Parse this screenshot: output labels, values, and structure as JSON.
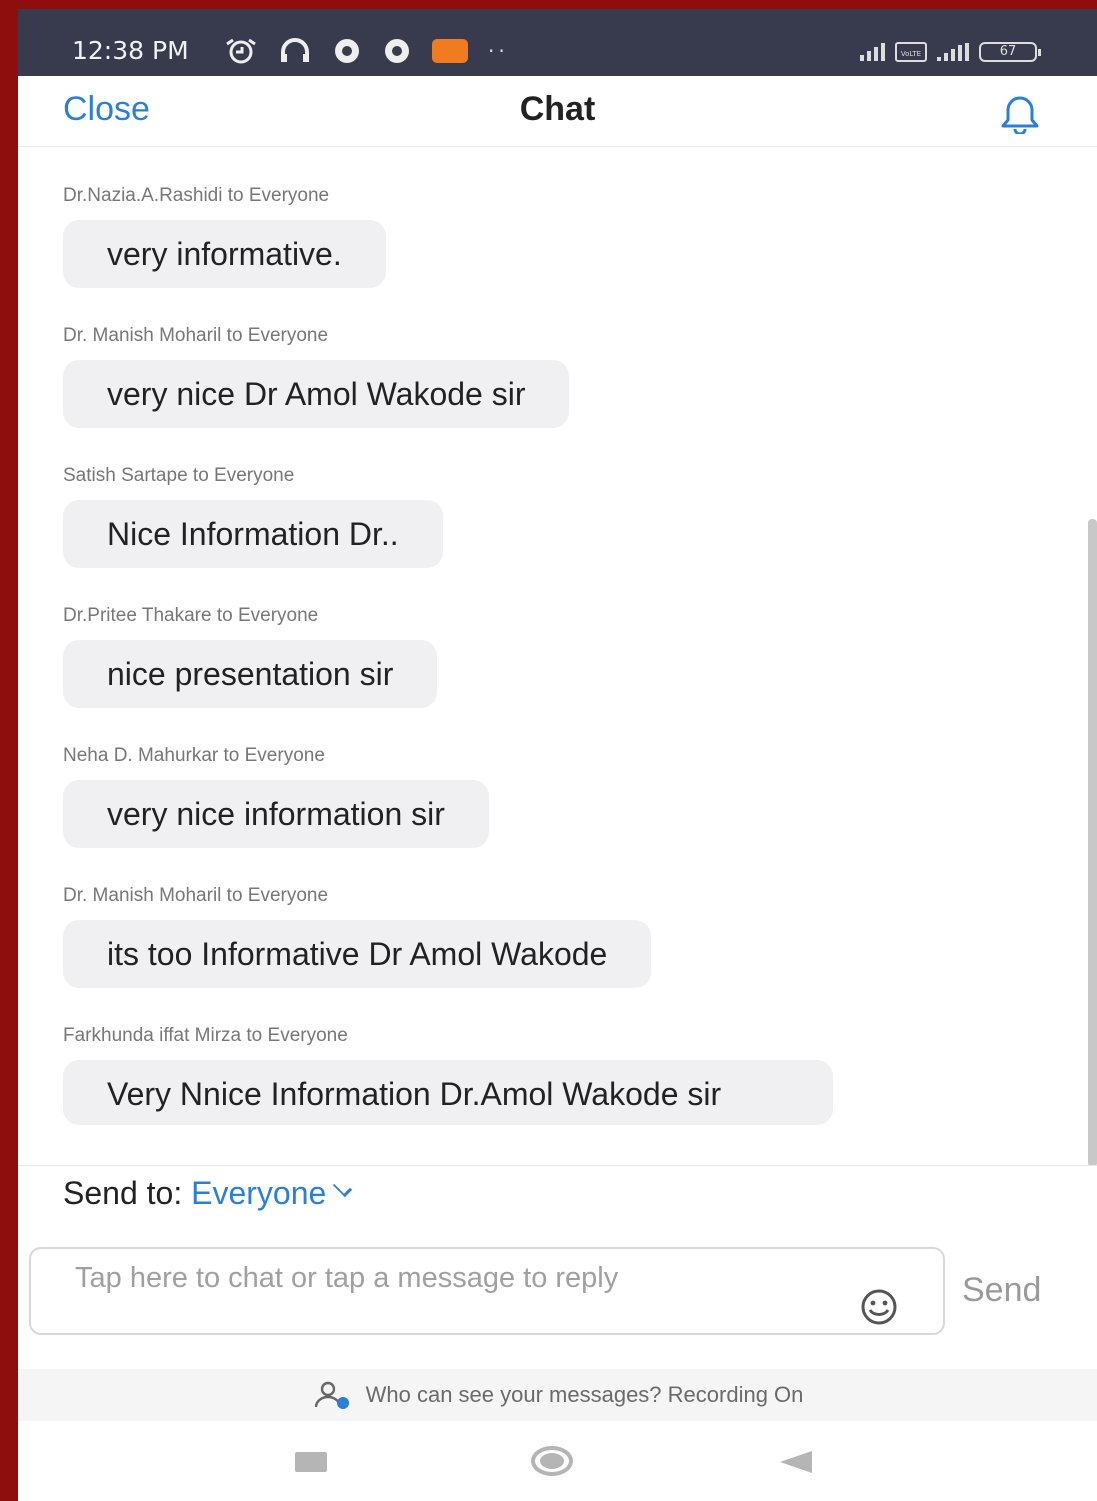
{
  "status_bar": {
    "time": "12:38 PM",
    "battery": "67",
    "volte": "VoLTE"
  },
  "header": {
    "close_label": "Close",
    "title": "Chat"
  },
  "messages": [
    {
      "sender": "Dr.Nazia.A.Rashidi to Everyone",
      "text": "very informative."
    },
    {
      "sender": "Dr. Manish Moharil to Everyone",
      "text": "very nice Dr Amol Wakode sir"
    },
    {
      "sender": "Satish Sartape to Everyone",
      "text": "Nice Information Dr.."
    },
    {
      "sender": "Dr.Pritee Thakare to Everyone",
      "text": "nice presentation sir"
    },
    {
      "sender": "Neha D. Mahurkar to Everyone",
      "text": "very nice information sir"
    },
    {
      "sender": "Dr. Manish Moharil to Everyone",
      "text": "its too Informative Dr Amol Wakode"
    },
    {
      "sender": "Farkhunda iffat Mirza to Everyone",
      "text": "Very Nnice Information Dr.Amol Wakode sir"
    }
  ],
  "composer": {
    "send_to_label": "Send to:",
    "send_to_target": "Everyone",
    "placeholder": "Tap here to chat or tap a message to reply",
    "send_label": "Send"
  },
  "notice": {
    "text": "Who can see your messages? Recording On"
  },
  "colors": {
    "accent": "#2c7fd6",
    "status_bar": "#383b4e",
    "bubble": "#f0f0f2",
    "border": "#8e0e0e"
  }
}
